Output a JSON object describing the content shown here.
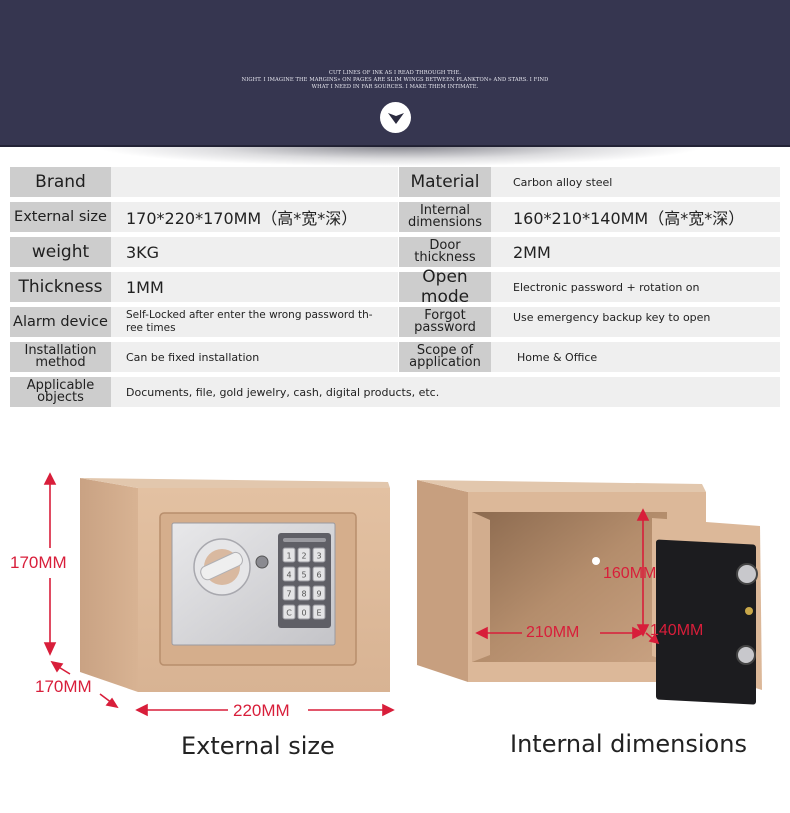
{
  "header": {
    "text_lines": [
      "CUT LINES OF INK AS I READ THROUGH THE.",
      "NIGHT. I IMAGINE THE MARGINS» ON PAGES ARE SLIM WINGS BETWEEN PLANKTON» AND STARS. I FIND",
      "WHAT I NEED IN FAR SOURCES. I MAKE THEM INTIMATE."
    ],
    "scroll_button_icon": "chevron-down-icon"
  },
  "specs": {
    "brand": {
      "label": "Brand",
      "value": ""
    },
    "material": {
      "label": "Material",
      "value": "Carbon alloy steel"
    },
    "external_size": {
      "label": "External size",
      "value": "170*220*170MM（高*宽*深）"
    },
    "internal_dimensions": {
      "label_line1": "Internal",
      "label_line2": "dimensions",
      "value": "160*210*140MM（高*宽*深）"
    },
    "weight": {
      "label": "weight",
      "value": "3KG"
    },
    "door_thickness": {
      "label_line1": "Door",
      "label_line2": "thickness",
      "value": "2MM"
    },
    "thickness": {
      "label": "Thickness",
      "value": "1MM"
    },
    "open_mode": {
      "label": "Open mode",
      "value": "Electronic password + rotation on"
    },
    "alarm_device": {
      "label": "Alarm device",
      "value_line1": "Self-Locked after enter the wrong password th-",
      "value_line2": "ree times"
    },
    "forgot_password": {
      "label_line1": "Forgot",
      "label_line2": "password",
      "value": "Use emergency backup key  to open"
    },
    "installation_method": {
      "label_line1": "Installation",
      "label_line2": "method",
      "value": "Can be fixed installation"
    },
    "scope_of_application": {
      "label_line1": "Scope of",
      "label_line2": "application",
      "value": "Home & Office"
    },
    "applicable_objects": {
      "label_line1": "Applicable",
      "label_line2": "objects",
      "value": "Documents, file, gold jewelry, cash, digital products, etc."
    }
  },
  "external_view": {
    "height_label": "170MM",
    "depth_label": "170MM",
    "width_label": "220MM",
    "caption": "External size",
    "keypad_keys": [
      "1",
      "2",
      "3",
      "4",
      "5",
      "6",
      "7",
      "8",
      "9",
      "C",
      "0",
      "E"
    ]
  },
  "internal_view": {
    "height_label": "160MM",
    "width_label": "210MM",
    "depth_label": "140MM",
    "caption": "Internal dimensions"
  },
  "colors": {
    "header_bg": "#363650",
    "label_bg": "#cdcdcd",
    "value_bg": "#efefef",
    "dimension_red": "#d81e3a",
    "safe_body": "#d9b28f"
  }
}
